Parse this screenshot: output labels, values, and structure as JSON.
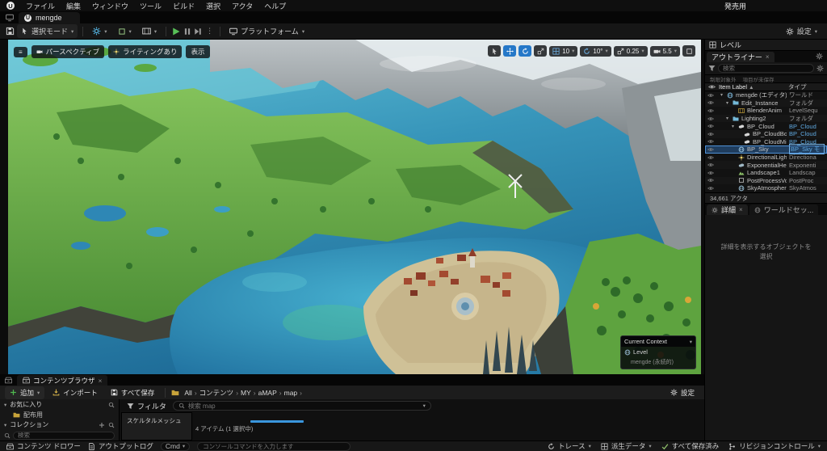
{
  "menu_bar": {
    "items": [
      "ファイル",
      "編集",
      "ウィンドウ",
      "ツール",
      "ビルド",
      "選択",
      "アクタ",
      "ヘルプ"
    ],
    "right_label": "発売用"
  },
  "tab_bar": {
    "active_tab": "mengde"
  },
  "main_toolbar": {
    "mode_dropdown": "選択モード",
    "platform_dropdown": "プラットフォーム",
    "settings": "設定"
  },
  "viewport": {
    "perspective": "パースペクティブ",
    "lit": "ライティングあり",
    "show": "表示",
    "snaps": [
      {
        "name": "grid-snap",
        "value": "10"
      },
      {
        "name": "rotation-snap",
        "value": "10°"
      },
      {
        "name": "scale-snap",
        "value": "0.25"
      },
      {
        "name": "camera-speed",
        "value": "5.5"
      }
    ],
    "context_overlay": {
      "title": "Current Context",
      "row_label": "Level",
      "row_value": "mengde (永続的)"
    }
  },
  "outliner": {
    "panel_tab": "レベル",
    "tab": "アウトライナー",
    "search_placeholder": "検索",
    "filter_chips": [
      "制限対象外",
      "項目が未保存"
    ],
    "columns": {
      "item": "Item Label",
      "sort": "▲",
      "type": "タイプ"
    },
    "rows": [
      {
        "label": "mengde (エディタ)",
        "type": "ワールド",
        "icon": "world",
        "indent": 0,
        "expanded": true
      },
      {
        "label": "Edit_Instance",
        "type": "フォルダ",
        "icon": "folder",
        "indent": 1,
        "expanded": true
      },
      {
        "label": "BlenderAnim",
        "type": "LevelSequ",
        "icon": "film",
        "indent": 2
      },
      {
        "label": "Lighting2",
        "type": "フォルダ",
        "icon": "folder",
        "indent": 1,
        "expanded": true
      },
      {
        "label": "BP_Cloud",
        "type": "BP_Cloud",
        "icon": "cloud",
        "indent": 2,
        "expanded": true,
        "type_link": true
      },
      {
        "label": "BP_CloudBotto",
        "type": "BP_Cloud",
        "icon": "cloud",
        "indent": 3,
        "type_link": true
      },
      {
        "label": "BP_CloudMiddl",
        "type": "BP_Cloud",
        "icon": "cloud",
        "indent": 3,
        "type_link": true
      },
      {
        "label": "BP_Sky",
        "type": "BP_Sky モ",
        "icon": "sky",
        "indent": 2,
        "type_link": true,
        "selected": true
      },
      {
        "label": "DirectionalLight",
        "type": "Directiona",
        "icon": "sun",
        "indent": 2
      },
      {
        "label": "ExponentialHeigh",
        "type": "Exponenti",
        "icon": "fog",
        "indent": 2
      },
      {
        "label": "Landscape1",
        "type": "Landscap",
        "icon": "mountain",
        "indent": 2
      },
      {
        "label": "PostProcessVolu",
        "type": "PostProc",
        "icon": "cube",
        "indent": 2
      },
      {
        "label": "SkyAtmosphere",
        "type": "SkyAtmos",
        "icon": "sky",
        "indent": 2
      }
    ],
    "status": "34,661 アクタ"
  },
  "details": {
    "tab": "詳細",
    "tab2": "ワールドセッ...",
    "empty_message": "詳細を表示するオブジェクトを選択"
  },
  "content_browser": {
    "tab": "コンテンツブラウザ",
    "add_button": "追加",
    "import_button": "インポート",
    "save_all_button": "すべて保存",
    "breadcrumb": [
      "All",
      "コンテンツ",
      "MY",
      "aMAP",
      "map"
    ],
    "settings": "設定",
    "favorites_header": "お気に入り",
    "favorite_item": "配布用",
    "collections_header": "コレクション",
    "collections_search_placeholder": "検索",
    "filter_button": "フィルタ",
    "search_placeholder": "検索 map",
    "filter_list_item": "スケルタルメッシュ",
    "items_status": "4 アイテム (1 選択中)"
  },
  "status_bar": {
    "content_drawer": "コンテンツ ドロワー",
    "output_log": "アウトプットログ",
    "cmd_label": "Cmd",
    "console_placeholder": "コンソールコマンドを入力します",
    "trace": "トレース",
    "derived_data": "派生データ",
    "save_status": "すべて保存済み",
    "revision_control": "リビジョンコントロール"
  },
  "colors": {
    "accent_blue": "#2578c8",
    "play_green": "#58c158",
    "link_blue": "#5fa8e0",
    "add_green": "#4fba4f"
  }
}
